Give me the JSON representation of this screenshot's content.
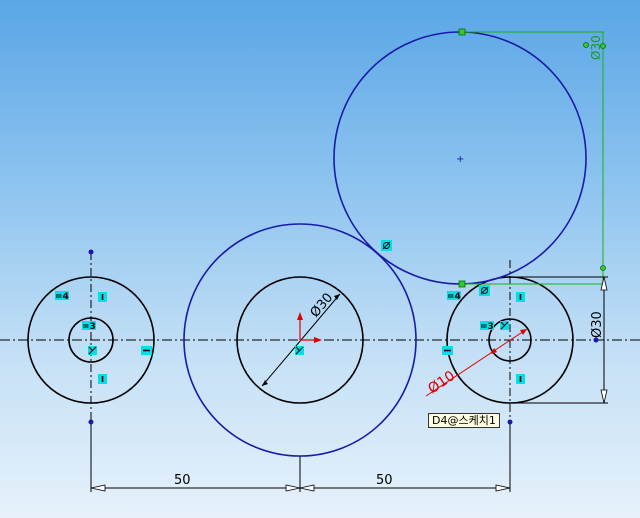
{
  "dimensions": {
    "horizontal_left": "50",
    "horizontal_right": "50",
    "diameter_center": "Ø30",
    "diameter_right_vertical": "Ø30",
    "diameter_red": "Ø10",
    "diameter_top_green": "Ø30"
  },
  "relations": {
    "tangent": "ↄ",
    "equal_4": "=4",
    "equal_3": "=3",
    "vertical": "I",
    "horizontal": "—"
  },
  "tooltip": {
    "text": "D4@스케치1"
  },
  "colors": {
    "sketch_black": "#000000",
    "selected_blue": "#1a1aa8",
    "dimension_red": "#e00000",
    "dimension_green": "#18b018",
    "relation_bg": "#00e0e8"
  }
}
